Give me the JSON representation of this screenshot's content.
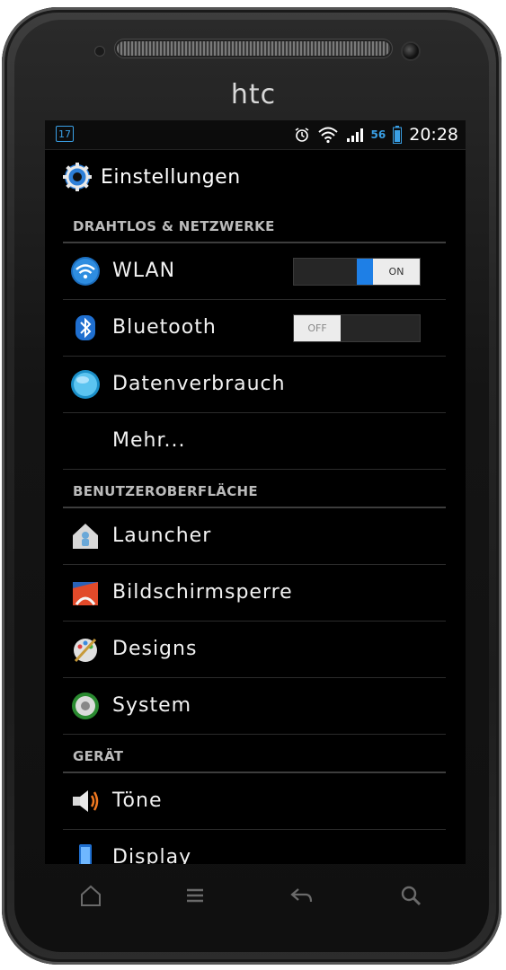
{
  "device": {
    "brand": "htc"
  },
  "statusbar": {
    "calendar_day": "17",
    "network": "56",
    "time": "20:28"
  },
  "header": {
    "title": "Einstellungen",
    "icon": "gear-icon"
  },
  "sections": [
    {
      "title": "DRAHTLOS & NETZWERKE"
    },
    {
      "title": "BENUTZEROBERFLÄCHE"
    },
    {
      "title": "GERÄT"
    }
  ],
  "items": {
    "wlan": {
      "label": "WLAN",
      "icon": "wifi-icon",
      "toggle": "ON"
    },
    "bluetooth": {
      "label": "Bluetooth",
      "icon": "bluetooth-icon",
      "toggle": "OFF"
    },
    "data": {
      "label": "Datenverbrauch",
      "icon": "data-usage-icon"
    },
    "more": {
      "label": "Mehr..."
    },
    "launcher": {
      "label": "Launcher",
      "icon": "launcher-icon"
    },
    "lockscreen": {
      "label": "Bildschirmsperre",
      "icon": "lockscreen-icon"
    },
    "designs": {
      "label": "Designs",
      "icon": "designs-icon"
    },
    "system": {
      "label": "System",
      "icon": "system-icon"
    },
    "sounds": {
      "label": "Töne",
      "icon": "speaker-icon"
    },
    "display": {
      "label": "Display",
      "icon": "display-icon"
    }
  },
  "navbar": [
    "home-icon",
    "menu-icon",
    "back-icon",
    "search-icon"
  ],
  "colors": {
    "accent": "#1e7fe6",
    "background": "#000000",
    "text": "#f2f2f2"
  }
}
